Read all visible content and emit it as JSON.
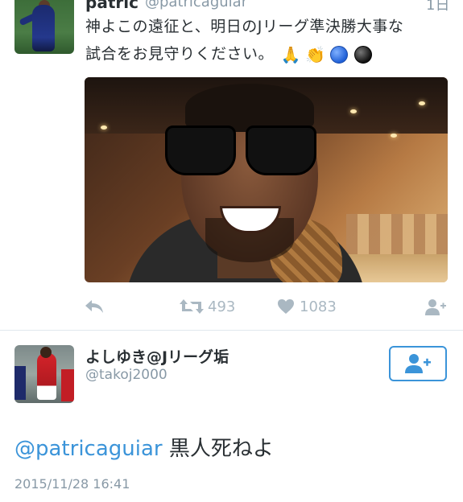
{
  "tweet1": {
    "author_name": "patric",
    "author_handle": "@patricaguiar",
    "time": "1日",
    "text_line1": "神よこの遠征と、明日のJリーグ準決勝大事な",
    "text_line2": "試合をお見守りください。",
    "emojis": [
      "folded-hands",
      "clapping-hands",
      "blue-circle",
      "black-circle"
    ],
    "retweet_count": "493",
    "like_count": "1083"
  },
  "tweet2": {
    "author_name": "よしゆき@Jリーグ垢",
    "author_handle": "@takoj2000",
    "reply_mention": "@patricaguiar",
    "reply_body": " 黒人死ねよ",
    "timestamp": "2015/11/28 16:41"
  },
  "colors": {
    "link": "#3b94d9",
    "muted": "#8899a6",
    "icon": "#aab8c2",
    "divider": "#e1e8ed"
  }
}
